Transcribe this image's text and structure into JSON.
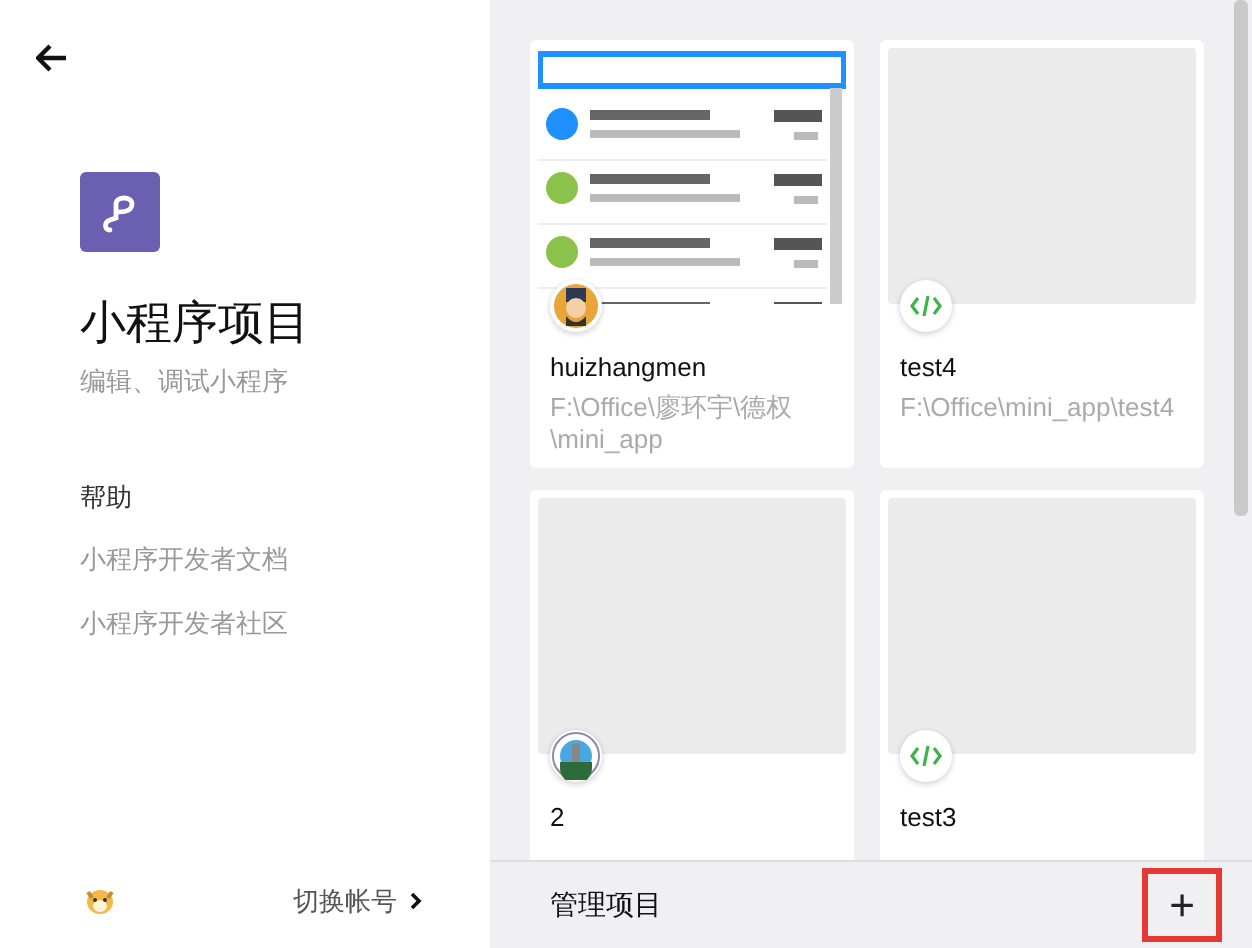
{
  "sidebar": {
    "title": "小程序项目",
    "subtitle": "编辑、调试小程序",
    "help_heading": "帮助",
    "help_links": [
      "小程序开发者文档",
      "小程序开发者社区"
    ],
    "switch_account": "切换帐号"
  },
  "projects": [
    {
      "name": "huizhangmen",
      "path": "F:\\Office\\廖环宇\\德权\\mini_app",
      "kind": "avatar"
    },
    {
      "name": "test4",
      "path": "F:\\Office\\mini_app\\test4",
      "kind": "code"
    },
    {
      "name": "2",
      "kind": "emblem"
    },
    {
      "name": "test3",
      "kind": "code"
    }
  ],
  "footer": {
    "label": "管理项目",
    "add_symbol": "+"
  }
}
